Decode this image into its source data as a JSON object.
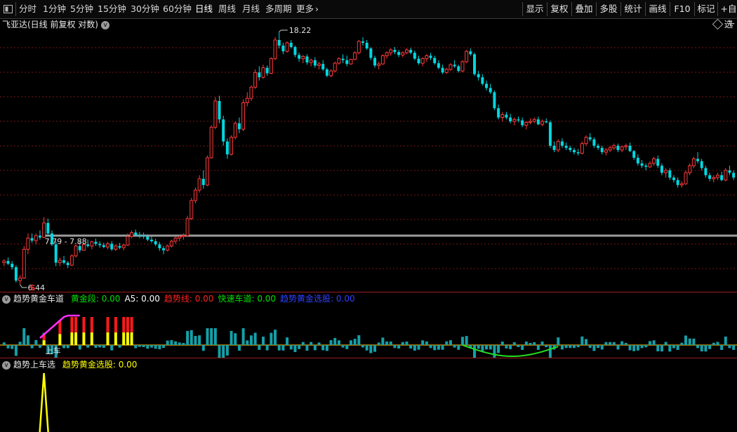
{
  "toolbar": {
    "periods": [
      "分时",
      "1分钟",
      "5分钟",
      "15分钟",
      "30分钟",
      "60分钟",
      "日线",
      "周线",
      "月线",
      "多周期",
      "更多"
    ],
    "active_period": "日线",
    "more_arrow": "›",
    "right_buttons": [
      "显示",
      "复权",
      "叠加",
      "多股",
      "统计",
      "画线",
      "F10",
      "标记",
      "+自选"
    ]
  },
  "main": {
    "title": "飞亚达(日线 前复权 对数)",
    "high_label": "18.22",
    "low_label": "6.44",
    "range_label": "7.79 - 7.88",
    "signal_mark": "S",
    "colors": {
      "up": "#ff3a3a",
      "down": "#00d8e0",
      "grid": "#7a1515",
      "ref_line": "#9c9c9c"
    }
  },
  "indicator1": {
    "name": "趋势黄金车道",
    "values": [
      {
        "label": "黄金段",
        "value": "0.00",
        "color": "#00e000"
      },
      {
        "label": "A5",
        "value": "0.00",
        "color": "#ffffff"
      },
      {
        "label": "趋势线",
        "value": "0.00",
        "color": "#ff2020"
      },
      {
        "label": "快速车道",
        "value": "0.00",
        "color": "#00e000"
      },
      {
        "label": "趋势黄金选股",
        "value": "0.00",
        "color": "#3040ff"
      }
    ],
    "annotation": "上车"
  },
  "indicator2": {
    "name": "趋势上车选",
    "values": [
      {
        "label": "趋势黄金选股",
        "value": "0.00",
        "color": "#ffff00"
      }
    ]
  },
  "chart_data": {
    "type": "candlestick",
    "title": "飞亚达(日线 前复权 对数)",
    "scale": "log",
    "high": 18.22,
    "low": 6.44,
    "range_marker": [
      7.79,
      7.88
    ],
    "candles": [
      [
        7.05,
        7.15,
        6.95,
        7.1
      ],
      [
        7.1,
        7.2,
        6.98,
        7.02
      ],
      [
        7.02,
        7.1,
        6.85,
        6.92
      ],
      [
        6.92,
        6.98,
        6.5,
        6.55
      ],
      [
        6.55,
        6.7,
        6.44,
        6.62
      ],
      [
        6.62,
        7.55,
        6.6,
        7.45
      ],
      [
        7.45,
        7.95,
        7.3,
        7.8
      ],
      [
        7.8,
        7.95,
        7.65,
        7.72
      ],
      [
        7.72,
        7.95,
        7.6,
        7.88
      ],
      [
        7.88,
        8.05,
        7.75,
        7.82
      ],
      [
        7.82,
        8.5,
        7.8,
        8.3
      ],
      [
        8.3,
        8.45,
        7.9,
        7.95
      ],
      [
        7.95,
        8.05,
        7.55,
        7.6
      ],
      [
        7.6,
        7.7,
        6.95,
        7.05
      ],
      [
        7.05,
        7.2,
        6.95,
        7.12
      ],
      [
        7.12,
        7.25,
        7.0,
        7.05
      ],
      [
        7.05,
        7.1,
        6.9,
        6.98
      ],
      [
        6.98,
        7.3,
        6.95,
        7.25
      ],
      [
        7.25,
        7.6,
        7.2,
        7.55
      ],
      [
        7.55,
        7.7,
        7.35,
        7.42
      ],
      [
        7.42,
        7.65,
        7.4,
        7.6
      ],
      [
        7.6,
        7.75,
        7.5,
        7.55
      ],
      [
        7.55,
        7.72,
        7.45,
        7.68
      ],
      [
        7.68,
        7.78,
        7.55,
        7.62
      ],
      [
        7.62,
        7.7,
        7.5,
        7.58
      ],
      [
        7.58,
        7.66,
        7.48,
        7.52
      ],
      [
        7.52,
        7.68,
        7.45,
        7.62
      ],
      [
        7.62,
        7.7,
        7.4,
        7.45
      ],
      [
        7.45,
        7.6,
        7.4,
        7.55
      ],
      [
        7.55,
        7.65,
        7.45,
        7.5
      ],
      [
        7.5,
        7.62,
        7.42,
        7.58
      ],
      [
        7.58,
        7.95,
        7.55,
        7.85
      ],
      [
        7.85,
        8.05,
        7.8,
        7.98
      ],
      [
        7.98,
        8.08,
        7.85,
        7.9
      ],
      [
        7.9,
        8.0,
        7.8,
        7.88
      ],
      [
        7.88,
        7.98,
        7.78,
        7.85
      ],
      [
        7.85,
        7.92,
        7.7,
        7.75
      ],
      [
        7.75,
        7.85,
        7.65,
        7.7
      ],
      [
        7.7,
        7.78,
        7.55,
        7.6
      ],
      [
        7.6,
        7.68,
        7.4,
        7.48
      ],
      [
        7.48,
        7.55,
        7.3,
        7.42
      ],
      [
        7.42,
        7.6,
        7.38,
        7.55
      ],
      [
        7.55,
        7.75,
        7.5,
        7.7
      ],
      [
        7.7,
        7.85,
        7.62,
        7.8
      ],
      [
        7.8,
        7.92,
        7.7,
        7.85
      ],
      [
        7.85,
        7.95,
        7.75,
        7.88
      ],
      [
        7.88,
        8.55,
        7.85,
        8.45
      ],
      [
        8.45,
        9.2,
        8.4,
        9.1
      ],
      [
        9.1,
        9.6,
        9.0,
        9.5
      ],
      [
        9.5,
        10.1,
        9.4,
        9.95
      ],
      [
        9.95,
        10.3,
        9.55,
        9.7
      ],
      [
        9.7,
        10.95,
        9.65,
        10.85
      ],
      [
        10.85,
        12.4,
        10.8,
        12.3
      ],
      [
        12.3,
        13.9,
        12.2,
        13.7
      ],
      [
        13.7,
        14.0,
        12.5,
        12.7
      ],
      [
        12.7,
        12.9,
        11.4,
        11.6
      ],
      [
        11.6,
        11.75,
        10.8,
        11.0
      ],
      [
        11.0,
        11.9,
        10.95,
        11.8
      ],
      [
        11.8,
        12.6,
        11.7,
        12.5
      ],
      [
        12.5,
        12.8,
        12.0,
        12.2
      ],
      [
        12.2,
        13.8,
        12.1,
        13.6
      ],
      [
        13.6,
        14.2,
        13.4,
        13.85
      ],
      [
        13.85,
        14.6,
        13.7,
        14.5
      ],
      [
        14.5,
        15.6,
        14.4,
        15.4
      ],
      [
        15.4,
        15.8,
        14.9,
        15.1
      ],
      [
        15.1,
        15.9,
        15.0,
        15.7
      ],
      [
        15.7,
        15.85,
        15.2,
        15.35
      ],
      [
        15.35,
        16.4,
        15.3,
        16.3
      ],
      [
        16.3,
        17.8,
        16.2,
        17.6
      ],
      [
        17.6,
        18.22,
        17.0,
        17.2
      ],
      [
        17.2,
        17.4,
        16.6,
        16.8
      ],
      [
        16.8,
        17.5,
        16.7,
        17.4
      ],
      [
        17.4,
        17.6,
        17.0,
        17.1
      ],
      [
        17.1,
        17.2,
        16.4,
        16.55
      ],
      [
        16.55,
        16.7,
        16.1,
        16.3
      ],
      [
        16.3,
        16.55,
        16.0,
        16.45
      ],
      [
        16.45,
        16.6,
        15.9,
        16.05
      ],
      [
        16.05,
        16.3,
        15.8,
        16.2
      ],
      [
        16.2,
        16.4,
        15.7,
        15.85
      ],
      [
        15.85,
        16.1,
        15.6,
        15.95
      ],
      [
        15.95,
        16.2,
        15.5,
        15.6
      ],
      [
        15.6,
        15.7,
        15.1,
        15.2
      ],
      [
        15.2,
        15.6,
        15.1,
        15.5
      ],
      [
        15.5,
        16.1,
        15.4,
        16.0
      ],
      [
        16.0,
        16.4,
        15.9,
        16.3
      ],
      [
        16.3,
        16.6,
        16.0,
        16.2
      ],
      [
        16.2,
        16.5,
        15.8,
        15.95
      ],
      [
        15.95,
        16.3,
        15.9,
        16.25
      ],
      [
        16.25,
        16.8,
        16.2,
        16.7
      ],
      [
        16.7,
        17.6,
        16.6,
        17.5
      ],
      [
        17.5,
        17.8,
        17.2,
        17.4
      ],
      [
        17.4,
        17.6,
        16.9,
        17.0
      ],
      [
        17.0,
        17.1,
        16.2,
        16.35
      ],
      [
        16.35,
        16.5,
        15.7,
        15.85
      ],
      [
        15.85,
        16.1,
        15.6,
        15.95
      ],
      [
        15.95,
        16.6,
        15.9,
        16.5
      ],
      [
        16.5,
        16.8,
        16.3,
        16.7
      ],
      [
        16.7,
        17.0,
        16.5,
        16.9
      ],
      [
        16.9,
        17.1,
        16.6,
        16.75
      ],
      [
        16.75,
        16.9,
        16.4,
        16.55
      ],
      [
        16.55,
        16.8,
        16.4,
        16.7
      ],
      [
        16.7,
        17.0,
        16.6,
        16.9
      ],
      [
        16.9,
        17.05,
        16.6,
        16.7
      ],
      [
        16.7,
        16.85,
        16.2,
        16.3
      ],
      [
        16.3,
        16.5,
        15.9,
        16.0
      ],
      [
        16.0,
        16.4,
        15.8,
        16.3
      ],
      [
        16.3,
        16.6,
        16.1,
        16.5
      ],
      [
        16.5,
        16.7,
        16.2,
        16.35
      ],
      [
        16.35,
        16.5,
        15.9,
        16.0
      ],
      [
        16.0,
        16.2,
        15.6,
        15.7
      ],
      [
        15.7,
        15.9,
        15.3,
        15.4
      ],
      [
        15.4,
        15.7,
        15.3,
        15.6
      ],
      [
        15.6,
        16.0,
        15.5,
        15.9
      ],
      [
        15.9,
        16.2,
        15.7,
        15.8
      ],
      [
        15.8,
        15.9,
        15.4,
        15.5
      ],
      [
        15.5,
        16.2,
        15.4,
        16.1
      ],
      [
        16.1,
        16.9,
        16.0,
        16.8
      ],
      [
        16.8,
        17.0,
        16.5,
        16.6
      ],
      [
        16.6,
        16.7,
        15.2,
        15.3
      ],
      [
        15.3,
        15.5,
        14.9,
        15.1
      ],
      [
        15.1,
        15.3,
        14.6,
        14.7
      ],
      [
        14.7,
        14.9,
        14.3,
        14.45
      ],
      [
        14.45,
        14.7,
        14.1,
        14.2
      ],
      [
        14.2,
        14.3,
        13.2,
        13.3
      ],
      [
        13.3,
        13.5,
        12.7,
        12.8
      ],
      [
        12.8,
        13.1,
        12.6,
        12.95
      ],
      [
        12.95,
        13.1,
        12.7,
        12.8
      ],
      [
        12.8,
        13.0,
        12.5,
        12.6
      ],
      [
        12.6,
        12.8,
        12.4,
        12.7
      ],
      [
        12.7,
        12.85,
        12.55,
        12.65
      ],
      [
        12.65,
        12.8,
        12.3,
        12.4
      ],
      [
        12.4,
        12.6,
        12.2,
        12.55
      ],
      [
        12.55,
        12.75,
        12.45,
        12.6
      ],
      [
        12.6,
        12.8,
        12.5,
        12.7
      ],
      [
        12.7,
        12.85,
        12.4,
        12.45
      ],
      [
        12.45,
        12.7,
        12.35,
        12.6
      ],
      [
        12.6,
        12.75,
        12.5,
        12.55
      ],
      [
        12.55,
        12.65,
        11.3,
        11.4
      ],
      [
        11.4,
        11.6,
        11.1,
        11.2
      ],
      [
        11.2,
        11.7,
        11.1,
        11.6
      ],
      [
        11.6,
        11.75,
        11.3,
        11.4
      ],
      [
        11.4,
        11.55,
        11.2,
        11.3
      ],
      [
        11.3,
        11.4,
        11.1,
        11.2
      ],
      [
        11.2,
        11.3,
        11.0,
        11.1
      ],
      [
        11.1,
        11.25,
        10.95,
        11.05
      ],
      [
        11.05,
        11.6,
        11.0,
        11.5
      ],
      [
        11.5,
        11.9,
        11.4,
        11.8
      ],
      [
        11.8,
        12.0,
        11.6,
        11.7
      ],
      [
        11.7,
        11.8,
        11.3,
        11.4
      ],
      [
        11.4,
        11.5,
        11.2,
        11.3
      ],
      [
        11.3,
        11.4,
        11.0,
        11.1
      ],
      [
        11.1,
        11.3,
        10.95,
        11.2
      ],
      [
        11.2,
        11.4,
        11.1,
        11.3
      ],
      [
        11.3,
        11.5,
        11.2,
        11.4
      ],
      [
        11.4,
        11.5,
        11.1,
        11.2
      ],
      [
        11.2,
        11.4,
        11.1,
        11.35
      ],
      [
        11.35,
        11.5,
        11.2,
        11.4
      ],
      [
        11.4,
        11.55,
        11.1,
        11.15
      ],
      [
        11.15,
        11.2,
        10.75,
        10.85
      ],
      [
        10.85,
        11.0,
        10.5,
        10.6
      ],
      [
        10.6,
        10.75,
        10.4,
        10.5
      ],
      [
        10.5,
        10.6,
        10.3,
        10.45
      ],
      [
        10.45,
        10.7,
        10.4,
        10.6
      ],
      [
        10.6,
        10.9,
        10.5,
        10.8
      ],
      [
        10.8,
        10.95,
        10.4,
        10.5
      ],
      [
        10.5,
        10.6,
        10.1,
        10.2
      ],
      [
        10.2,
        10.4,
        10.0,
        10.3
      ],
      [
        10.3,
        10.4,
        9.9,
        10.0
      ],
      [
        10.0,
        10.1,
        9.8,
        9.9
      ],
      [
        9.9,
        10.0,
        9.6,
        9.7
      ],
      [
        9.7,
        9.85,
        9.6,
        9.75
      ],
      [
        9.75,
        10.3,
        9.7,
        10.2
      ],
      [
        10.2,
        10.6,
        10.1,
        10.5
      ],
      [
        10.5,
        10.9,
        10.4,
        10.8
      ],
      [
        10.8,
        11.1,
        10.6,
        10.7
      ],
      [
        10.7,
        10.8,
        10.3,
        10.4
      ],
      [
        10.4,
        10.5,
        10.0,
        10.1
      ],
      [
        10.1,
        10.2,
        9.85,
        9.95
      ],
      [
        9.95,
        10.1,
        9.8,
        10.0
      ],
      [
        10.0,
        10.2,
        9.9,
        10.1
      ],
      [
        10.1,
        10.25,
        9.85,
        9.9
      ],
      [
        9.9,
        10.4,
        9.85,
        10.3
      ],
      [
        10.3,
        10.5,
        10.1,
        10.2
      ],
      [
        10.2,
        10.3,
        9.9,
        10.0
      ]
    ]
  }
}
